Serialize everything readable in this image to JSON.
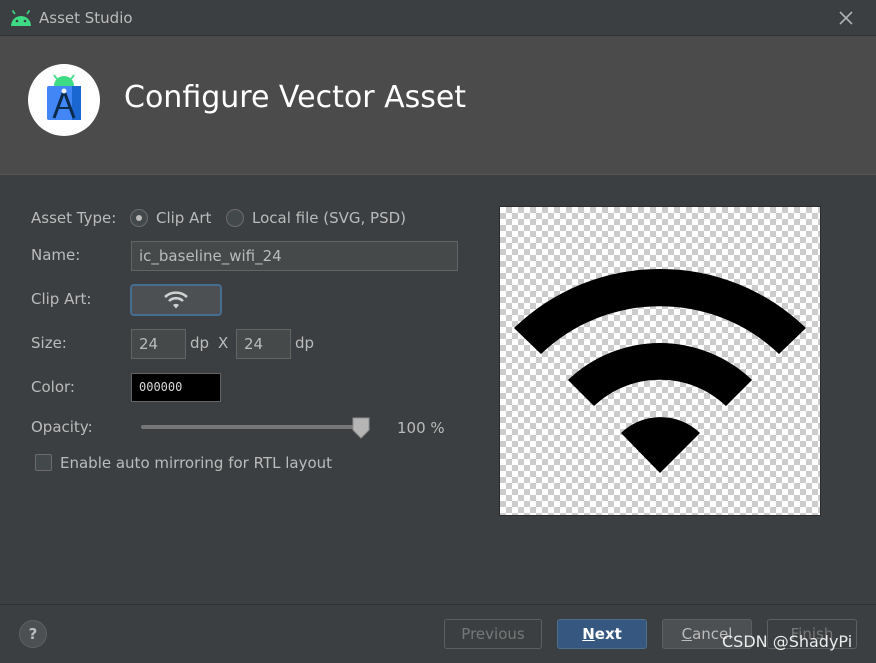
{
  "window": {
    "title": "Asset Studio",
    "icon": "android-icon",
    "close_icon": "close-icon"
  },
  "header": {
    "title": "Configure Vector Asset",
    "logo": "android-studio-logo"
  },
  "form": {
    "asset_type": {
      "label": "Asset Type:",
      "options": [
        {
          "label": "Clip Art",
          "checked": true
        },
        {
          "label": "Local file (SVG, PSD)",
          "checked": false
        }
      ]
    },
    "name": {
      "label": "Name:",
      "value": "ic_baseline_wifi_24"
    },
    "clip_art": {
      "label": "Clip Art:",
      "icon": "wifi-icon"
    },
    "size": {
      "label": "Size:",
      "width": "24",
      "height": "24",
      "unit": "dp",
      "separator": "X"
    },
    "color": {
      "label": "Color:",
      "value": "000000",
      "swatch": "#000000"
    },
    "opacity": {
      "label": "Opacity:",
      "value_text": "100 %",
      "value": 100
    },
    "auto_mirror": {
      "label": "Enable auto mirroring for RTL layout",
      "checked": false
    }
  },
  "preview": {
    "icon": "wifi-icon",
    "fill": "#000000"
  },
  "footer": {
    "help_label": "?",
    "previous": {
      "mnemonic": "",
      "rest": "Previous",
      "enabled": false
    },
    "next": {
      "mnemonic": "N",
      "rest": "ext",
      "enabled": true
    },
    "cancel": {
      "mnemonic": "C",
      "rest": "ancel",
      "enabled": true
    },
    "finish": {
      "mnemonic": "",
      "rest": "Finish",
      "enabled": false
    }
  },
  "watermark": "CSDN @ShadyPi",
  "colors": {
    "background": "#3c3f41",
    "header": "#4b4b4b",
    "accent": "#365880",
    "focus": "#466d94"
  }
}
